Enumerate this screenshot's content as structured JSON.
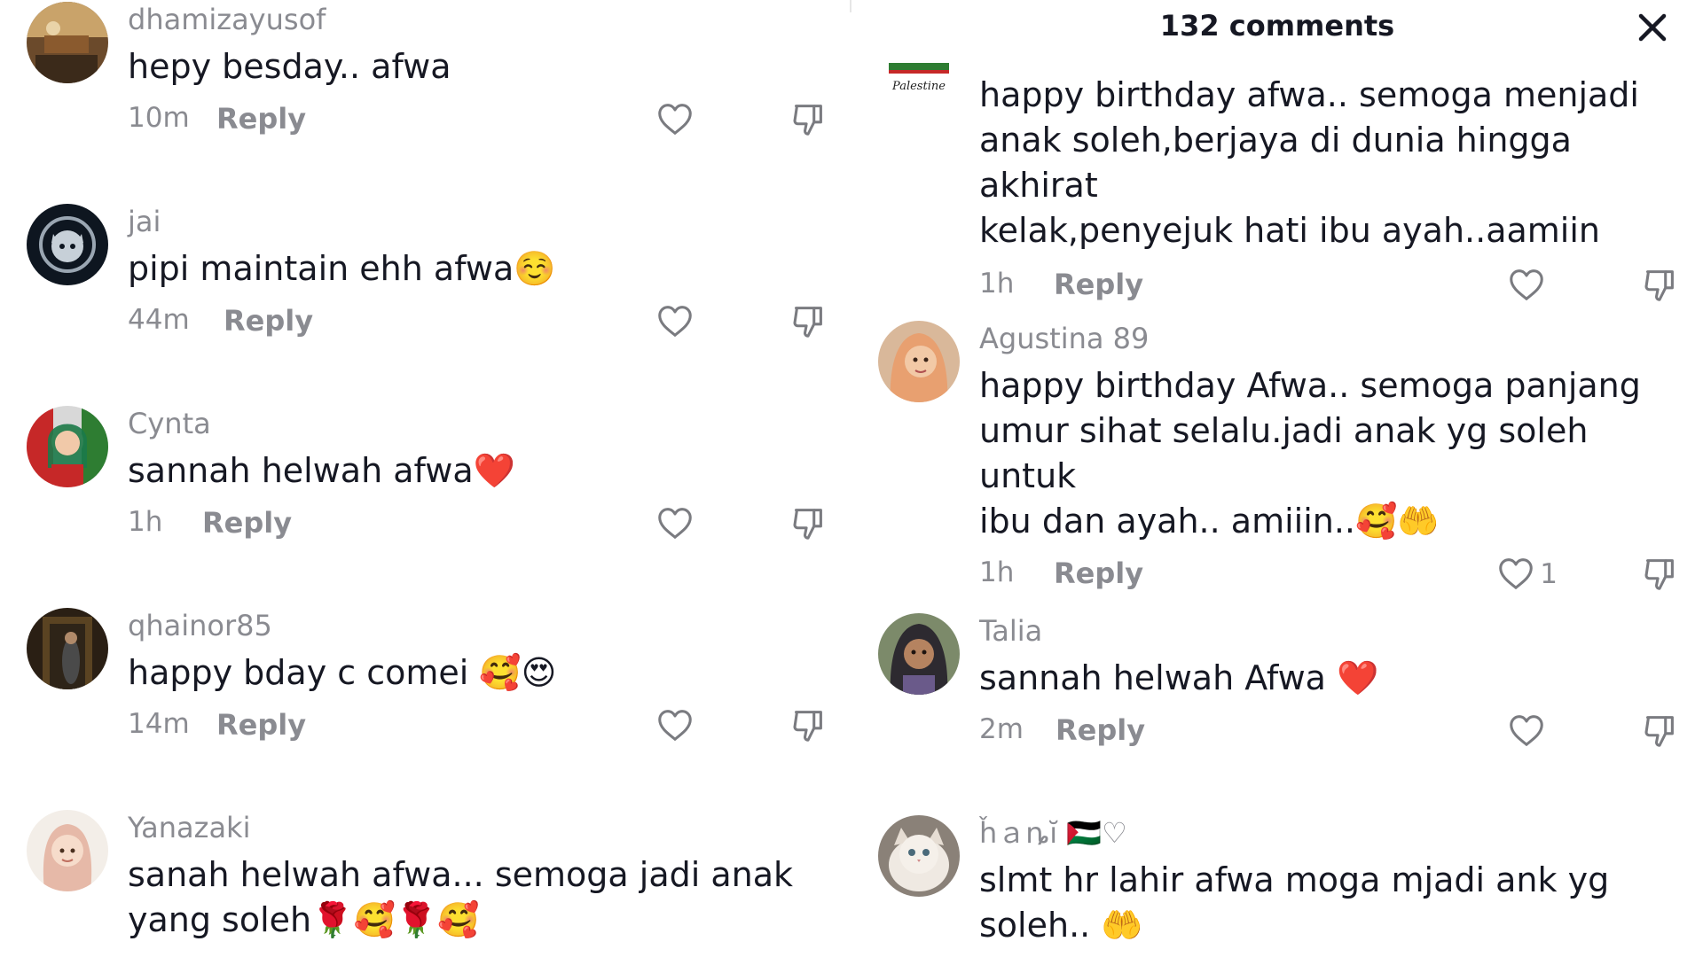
{
  "header": {
    "title": "132 comments"
  },
  "left_comments": [
    {
      "username": "dhamizayusof",
      "text": "hepy besday.. afwa",
      "time": "10m",
      "reply": "Reply",
      "likes": ""
    },
    {
      "username": "jai",
      "text": "pipi maintain ehh afwa☺️",
      "time": "44m",
      "reply": "Reply",
      "likes": ""
    },
    {
      "username": "Cynta",
      "text": "sannah helwah afwa❤️",
      "time": "1h",
      "reply": "Reply",
      "likes": ""
    },
    {
      "username": "qhainor85",
      "text": "happy bday c comei 🥰😍",
      "time": "14m",
      "reply": "Reply",
      "likes": ""
    },
    {
      "username": "Yanazaki",
      "text": "sanah helwah afwa... semoga jadi anak\nyang soleh🌹🥰🌹🥰",
      "time": "",
      "reply": "",
      "likes": ""
    }
  ],
  "right_comments": [
    {
      "username": "",
      "avatar_text": "Palestine",
      "text": "happy birthday afwa.. semoga menjadi\nanak soleh,berjaya di dunia hingga akhirat\nkelak,penyejuk hati ibu ayah..aamiin",
      "time": "1h",
      "reply": "Reply",
      "likes": ""
    },
    {
      "username": "Agustina 89",
      "text": "happy birthday Afwa.. semoga panjang\numur sihat selalu.jadi anak yg soleh untuk\nibu dan ayah.. amiiin..🥰🤲",
      "time": "1h",
      "reply": "Reply",
      "likes": "1"
    },
    {
      "username": "Talia",
      "text": "sannah helwah Afwa ❤️",
      "time": "2m",
      "reply": "Reply",
      "likes": ""
    },
    {
      "username": "ȟａȵĭ 🇵🇸♡",
      "text": "slmt hr lahir afwa moga mjadi ank yg\nsoleh.. 🤲",
      "time": "",
      "reply": "",
      "likes": ""
    }
  ],
  "icons": {
    "like": "heart-outline-icon",
    "dislike": "thumbs-down-icon",
    "close": "close-icon"
  },
  "colors": {
    "text": "#161823",
    "muted": "#8a8b91",
    "background": "#ffffff"
  }
}
